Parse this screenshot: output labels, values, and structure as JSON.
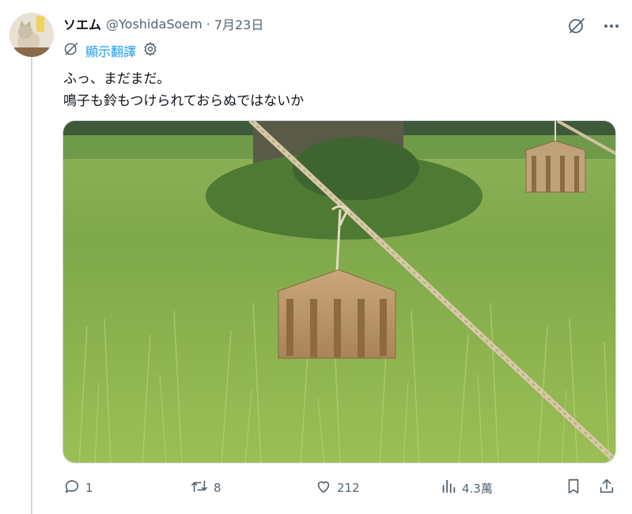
{
  "tweet": {
    "display_name": "ソエム",
    "handle": "@YoshidaSoem",
    "separator": "·",
    "date": "7月23日",
    "translate_label": "顯示翻譯",
    "text_lines": [
      "ふっ、まだまだ。",
      "鳴子も鈴もつけられておらぬではないか"
    ]
  },
  "actions": {
    "replies": "1",
    "retweets": "8",
    "likes": "212",
    "views": "4.3萬"
  },
  "icons": {
    "top": [
      "grok-icon",
      "more-icon"
    ],
    "translate": [
      "grok-icon",
      "gear-icon"
    ],
    "actions": [
      "reply-icon",
      "retweet-icon",
      "like-icon",
      "views-icon",
      "bookmark-icon",
      "share-icon"
    ]
  },
  "colors": {
    "link": "#1d9bf0",
    "muted": "#536471",
    "text": "#0f1419"
  }
}
